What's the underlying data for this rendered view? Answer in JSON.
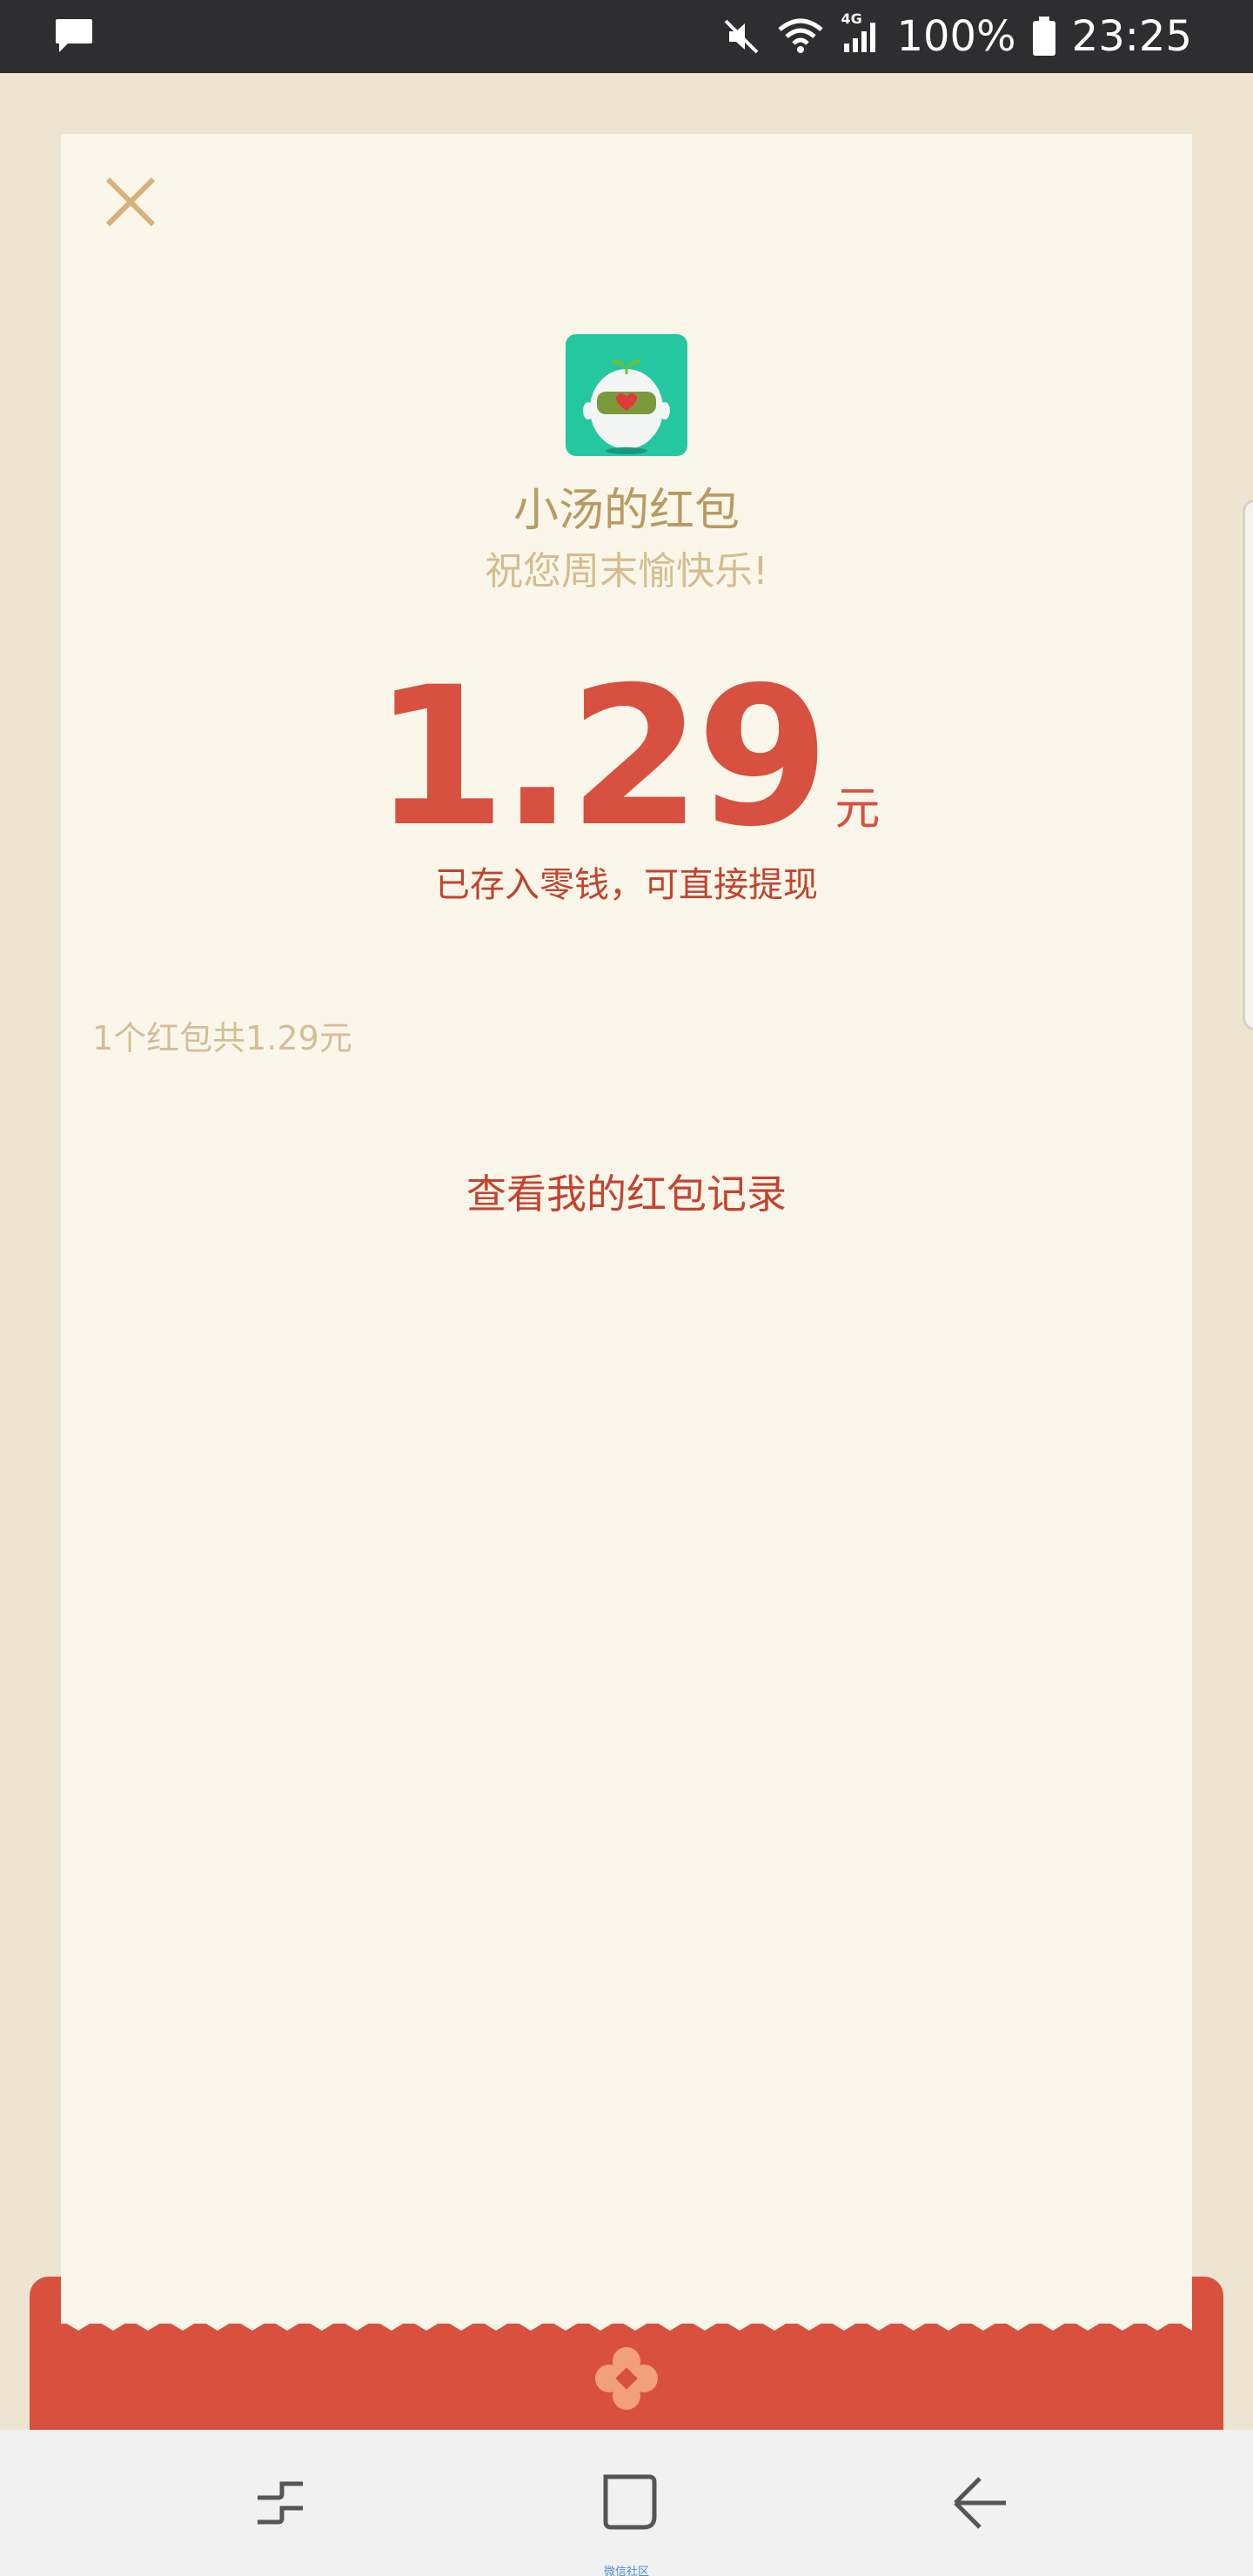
{
  "status_bar": {
    "icons": [
      "chat-notification-icon",
      "mute-icon",
      "wifi-icon",
      "signal-4g-icon",
      "battery-icon"
    ],
    "network_label": "4G",
    "battery_text": "100%",
    "time": "23:25"
  },
  "red_packet": {
    "sender": "小汤的红包",
    "wish": "祝您周末愉快乐!",
    "amount": "1.29",
    "unit": "元",
    "stored_note": "已存入零钱，可直接提现",
    "summary": "1个红包共1.29元",
    "record_link": "查看我的红包记录"
  },
  "nav_bar": {
    "icons": [
      "recents-icon",
      "home-icon",
      "back-icon"
    ],
    "caption": "微信社区"
  },
  "colors": {
    "accent_red": "#d8503f",
    "gold_text": "#b99a61",
    "paper": "#faf6ea",
    "background": "#ede5d1",
    "avatar_bg": "#25c7a1"
  }
}
